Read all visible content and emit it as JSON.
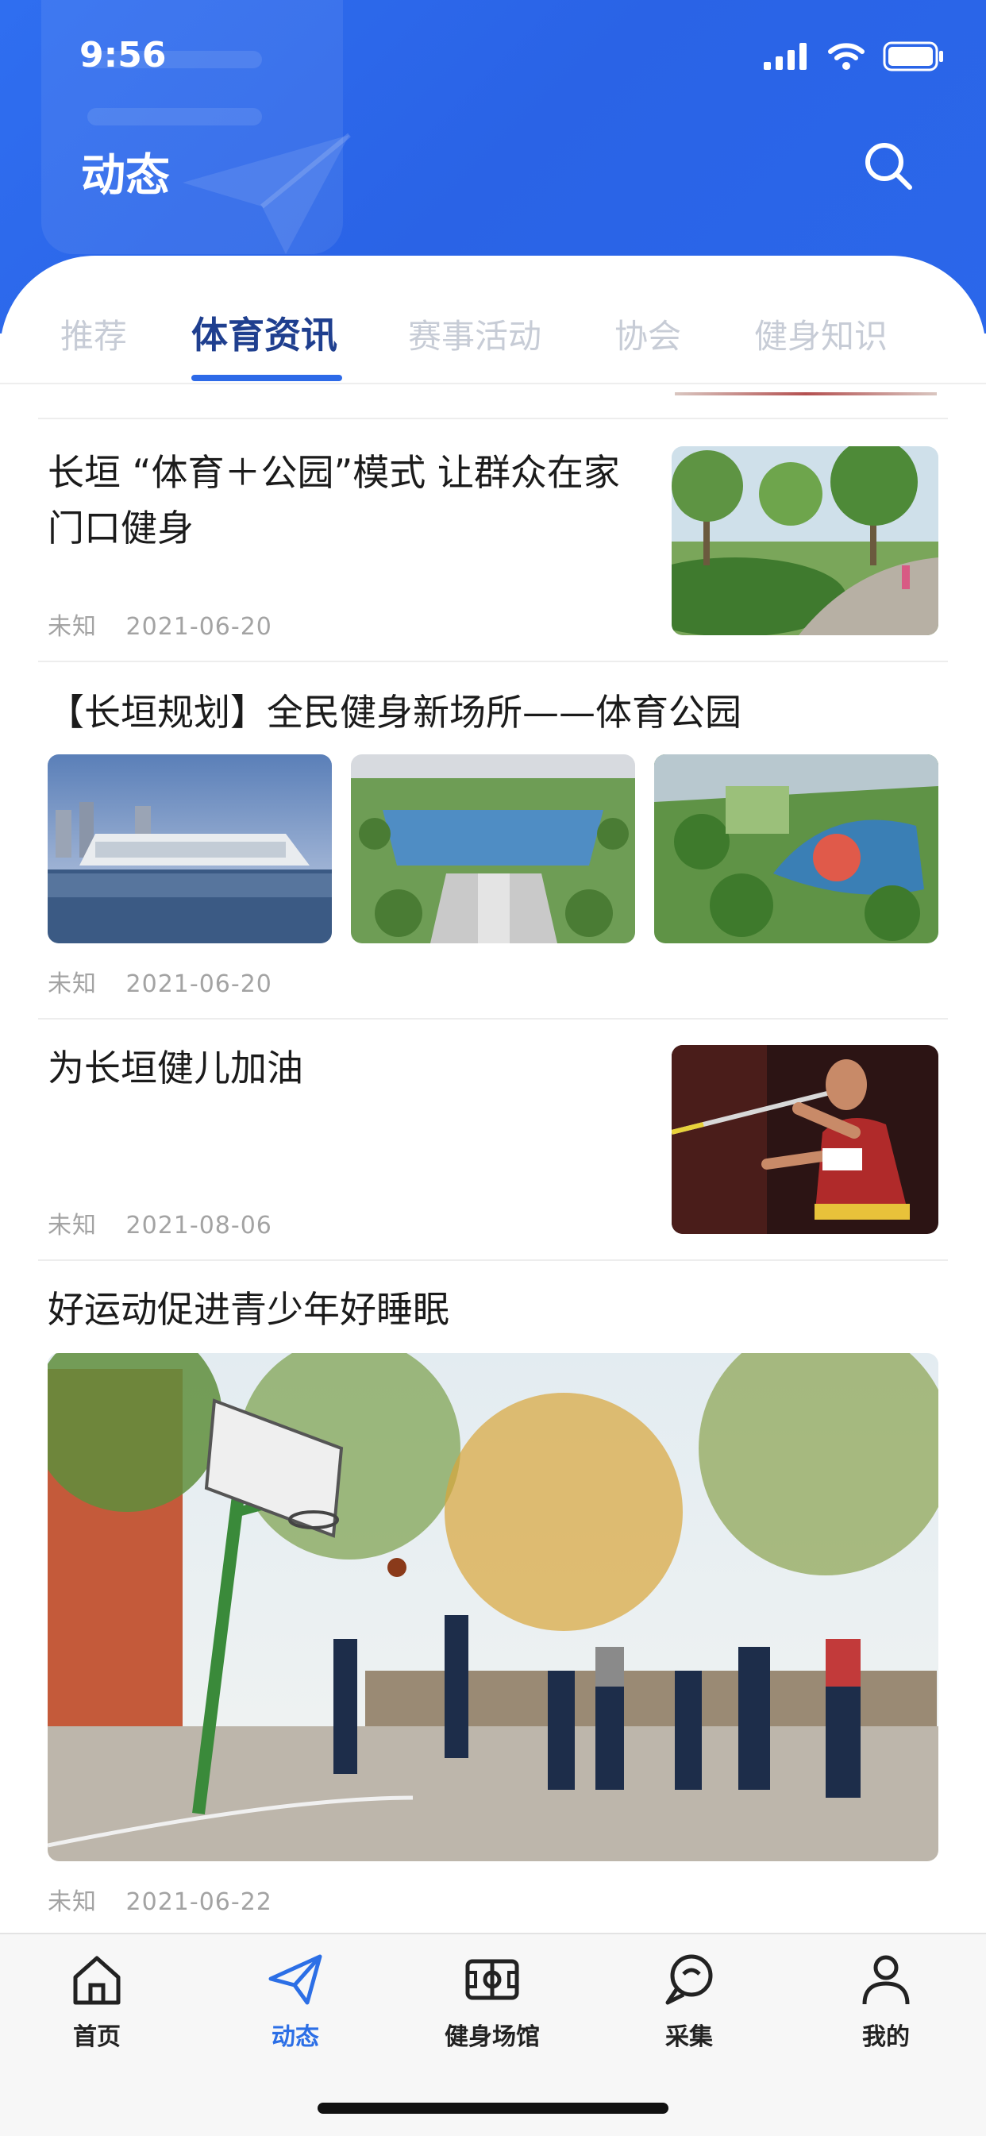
{
  "status_bar": {
    "time": "9:56"
  },
  "header": {
    "title": "动态"
  },
  "tabs": [
    {
      "label": "推荐",
      "active": false
    },
    {
      "label": "体育资讯",
      "active": true
    },
    {
      "label": "赛事活动",
      "active": false
    },
    {
      "label": "协会",
      "active": false
    },
    {
      "label": "健身知识",
      "active": false
    }
  ],
  "news": [
    {
      "title_line1": "长垣 “体育＋公园”模式 让群众在家",
      "title_line2": "门口健身",
      "source": "未知",
      "date": "2021-06-20"
    },
    {
      "title": "【长垣规划】全民健身新场所——体育公园",
      "source": "未知",
      "date": "2021-06-20"
    },
    {
      "title": "为长垣健儿加油",
      "source": "未知",
      "date": "2021-08-06"
    },
    {
      "title": "好运动促进青少年好睡眠",
      "source": "未知",
      "date": "2021-06-22"
    }
  ],
  "bottom_nav": [
    {
      "label": "首页",
      "icon": "home-icon",
      "active": false
    },
    {
      "label": "动态",
      "icon": "paper-plane-icon",
      "active": true
    },
    {
      "label": "健身场馆",
      "icon": "stadium-icon",
      "active": false
    },
    {
      "label": "采集",
      "icon": "collect-pin-icon",
      "active": false
    },
    {
      "label": "我的",
      "icon": "user-icon",
      "active": false
    }
  ],
  "colors": {
    "primary": "#2d6ae8",
    "tab_active": "#1f3f8f",
    "tab_inactive": "#c7ccd6",
    "meta": "#a3a3a3"
  }
}
